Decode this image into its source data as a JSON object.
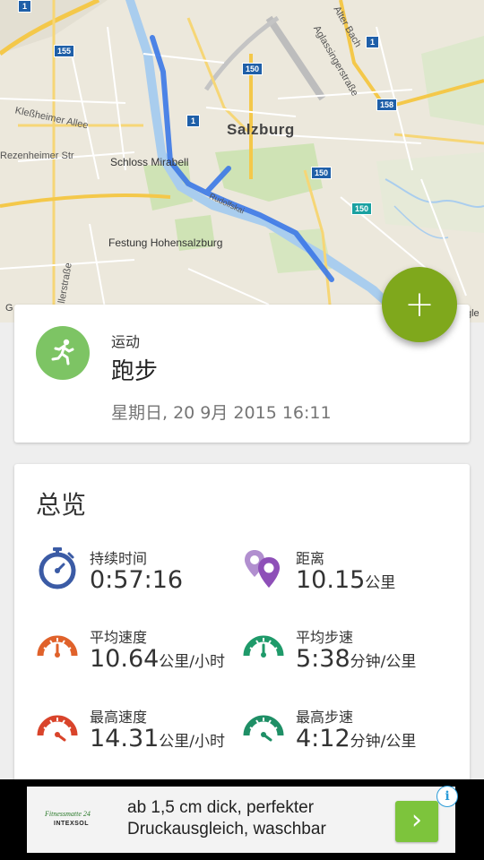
{
  "map": {
    "city_label": "Salzburg",
    "poi_labels": [
      "Schloss Mirabell",
      "Festung Hohensalzburg"
    ],
    "street_labels": [
      "Kleßheimer Allee",
      "Rezenheimer Str",
      "Aglassingerstraße",
      "Alter Bach",
      "llerstraße",
      "Rudolfskai"
    ],
    "road_shields": [
      "155",
      "150",
      "1",
      "150",
      "1",
      "158",
      "1",
      "150"
    ],
    "attribution_left": "G",
    "attribution_right": "gle",
    "route_color": "#3b78e7"
  },
  "fab": {
    "icon": "plus-icon",
    "label": "+",
    "color": "#7fa81c"
  },
  "activity": {
    "icon": "running-person-icon",
    "icon_color": "#7dc464",
    "type_label": "运动",
    "name": "跑步",
    "datetime": "星期日, 20 9月 2015 16:11"
  },
  "overview": {
    "title": "总览",
    "stats": [
      {
        "label": "持续时间",
        "value": "0:57:16",
        "unit": "",
        "icon": "stopwatch-icon",
        "color": "#3b5ba5"
      },
      {
        "label": "距离",
        "value": "10.15",
        "unit": "公里",
        "icon": "location-pins-icon",
        "color": "#8e4fb8"
      },
      {
        "label": "平均速度",
        "value": "10.64",
        "unit": "公里/小时",
        "icon": "speedometer-icon",
        "color": "#e0622b"
      },
      {
        "label": "平均步速",
        "value": "5:38",
        "unit": "分钟/公里",
        "icon": "pace-gauge-icon",
        "color": "#1f9a6a"
      },
      {
        "label": "最高速度",
        "value": "14.31",
        "unit": "公里/小时",
        "icon": "speedometer-icon",
        "color": "#d9442b"
      },
      {
        "label": "最高步速",
        "value": "4:12",
        "unit": "分钟/公里",
        "icon": "pace-gauge-icon",
        "color": "#1f8f66"
      }
    ]
  },
  "ad": {
    "logo_top": "Fitnessmatte 24",
    "logo_bottom": "INTEXSOL",
    "text": "ab 1,5 cm dick, perfekter Druckausgleich, waschbar",
    "cta_icon": "chevron-right-icon",
    "cta_label": "›",
    "info_icon": "info-icon",
    "info_label": "i"
  }
}
